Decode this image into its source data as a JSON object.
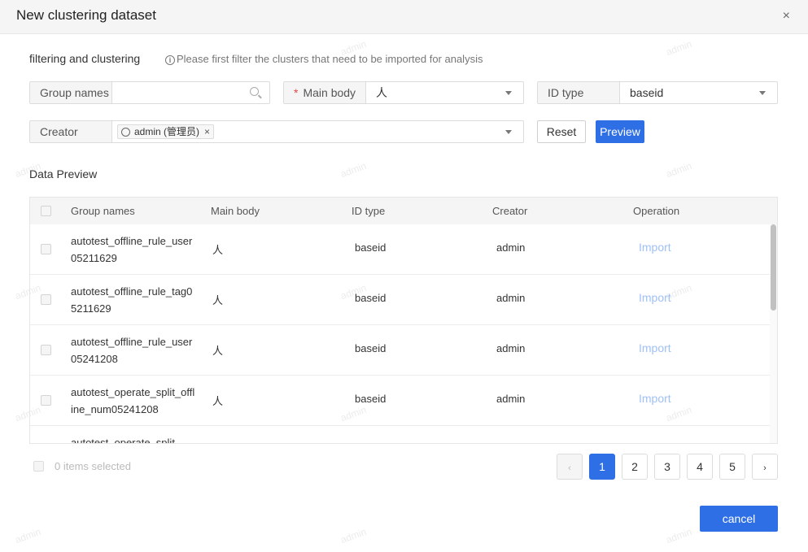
{
  "dialog": {
    "title": "New clustering dataset",
    "close_icon": "×"
  },
  "filter": {
    "section_title": "filtering and clustering",
    "hint_icon": "i",
    "hint": "Please first filter the clusters that need to be imported for analysis",
    "group_names": {
      "label": "Group names",
      "value": "",
      "placeholder": ""
    },
    "main_body": {
      "required_mark": "*",
      "label": "Main body",
      "value": "人"
    },
    "id_type": {
      "label": "ID type",
      "value": "baseid"
    },
    "creator": {
      "label": "Creator",
      "tag": "admin (管理员)",
      "tag_remove": "×"
    },
    "reset_label": "Reset",
    "preview_label": "Preview"
  },
  "preview": {
    "title": "Data Preview",
    "columns": [
      "Group names",
      "Main body",
      "ID type",
      "Creator",
      "Operation"
    ],
    "rows": [
      {
        "name": "autotest_offline_rule_user05211629",
        "body": "人",
        "id_type": "baseid",
        "creator": "admin",
        "op": "Import"
      },
      {
        "name": "autotest_offline_rule_tag05211629",
        "body": "人",
        "id_type": "baseid",
        "creator": "admin",
        "op": "Import"
      },
      {
        "name": "autotest_offline_rule_user05241208",
        "body": "人",
        "id_type": "baseid",
        "creator": "admin",
        "op": "Import"
      },
      {
        "name": "autotest_operate_split_offline_num05241208",
        "body": "人",
        "id_type": "baseid",
        "creator": "admin",
        "op": "Import"
      },
      {
        "name": "autotest_operate_split",
        "body": "",
        "id_type": "",
        "creator": "",
        "op": ""
      }
    ],
    "selected_text": "0 items selected"
  },
  "pagination": {
    "prev": "‹",
    "next": "›",
    "pages": [
      "1",
      "2",
      "3",
      "4",
      "5"
    ],
    "current": "1"
  },
  "footer": {
    "cancel_label": "cancel"
  },
  "watermark": "admin",
  "colors": {
    "primary": "#2f6fe6",
    "link_disabled": "#9fc1f5",
    "required": "#e64545"
  }
}
